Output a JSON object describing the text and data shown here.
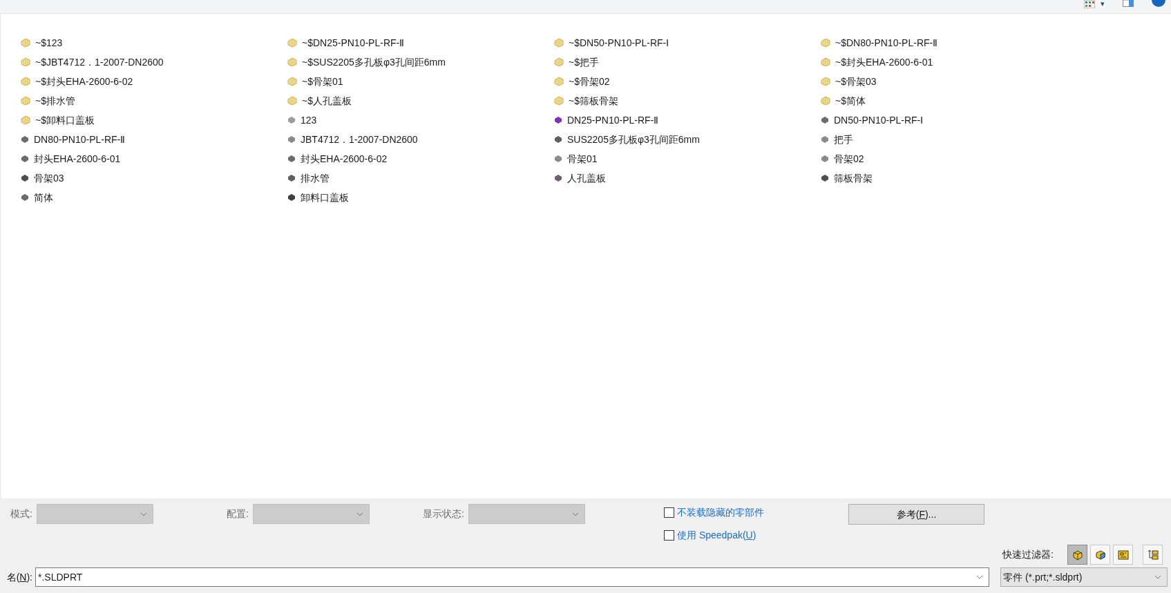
{
  "toolbar": {
    "view_menu_caret": "▾"
  },
  "files": [
    {
      "name": "~$123",
      "kind": "temp"
    },
    {
      "name": "~$DN25-PN10-PL-RF-Ⅱ",
      "kind": "temp"
    },
    {
      "name": "~$DN50-PN10-PL-RF-Ⅰ",
      "kind": "temp"
    },
    {
      "name": "~$DN80-PN10-PL-RF-Ⅱ",
      "kind": "temp"
    },
    {
      "name": "~$JBT4712．1-2007-DN2600",
      "kind": "temp"
    },
    {
      "name": "~$SUS2205多孔板φ3孔间距6mm",
      "kind": "temp"
    },
    {
      "name": "~$把手",
      "kind": "temp"
    },
    {
      "name": "~$封头EHA-2600-6-01",
      "kind": "temp"
    },
    {
      "name": "~$封头EHA-2600-6-02",
      "kind": "temp"
    },
    {
      "name": "~$骨架01",
      "kind": "temp"
    },
    {
      "name": "~$骨架02",
      "kind": "temp"
    },
    {
      "name": "~$骨架03",
      "kind": "temp"
    },
    {
      "name": "~$排水管",
      "kind": "temp"
    },
    {
      "name": "~$人孔盖板",
      "kind": "temp"
    },
    {
      "name": "~$筛板骨架",
      "kind": "temp"
    },
    {
      "name": "~$简体",
      "kind": "temp"
    },
    {
      "name": "~$卸料口盖板",
      "kind": "temp"
    },
    {
      "name": "123",
      "kind": "part",
      "color": "#9a9aa0"
    },
    {
      "name": "DN25-PN10-PL-RF-Ⅱ",
      "kind": "part",
      "color": "#7b2fbf"
    },
    {
      "name": "DN50-PN10-PL-RF-Ⅰ",
      "kind": "part",
      "color": "#6b6b74"
    },
    {
      "name": "DN80-PN10-PL-RF-Ⅱ",
      "kind": "part",
      "color": "#6b6b74"
    },
    {
      "name": "JBT4712．1-2007-DN2600",
      "kind": "part",
      "color": "#8a8a92"
    },
    {
      "name": "SUS2205多孔板φ3孔间距6mm",
      "kind": "part",
      "color": "#5e5e66"
    },
    {
      "name": "把手",
      "kind": "part",
      "color": "#8a8a92"
    },
    {
      "name": "封头EHA-2600-6-01",
      "kind": "part",
      "color": "#6b6b74"
    },
    {
      "name": "封头EHA-2600-6-02",
      "kind": "part",
      "color": "#6b6b74"
    },
    {
      "name": "骨架01",
      "kind": "part",
      "color": "#8a8a92"
    },
    {
      "name": "骨架02",
      "kind": "part",
      "color": "#8a8a92"
    },
    {
      "name": "骨架03",
      "kind": "part",
      "color": "#4e4e56"
    },
    {
      "name": "排水管",
      "kind": "part",
      "color": "#5e5e66"
    },
    {
      "name": "人孔盖板",
      "kind": "part",
      "color": "#6e5e6e"
    },
    {
      "name": "筛板骨架",
      "kind": "part",
      "color": "#4e4e56"
    },
    {
      "name": "简体",
      "kind": "part",
      "color": "#6b6b74"
    },
    {
      "name": "卸料口盖板",
      "kind": "part",
      "color": "#3e3e46"
    }
  ],
  "options": {
    "dropdowns": [
      {
        "label": "模式:",
        "disabled": true
      },
      {
        "label": "配置:",
        "disabled": true
      },
      {
        "label": "显示状态:",
        "disabled": true
      }
    ],
    "checkboxes": [
      {
        "label": "不装载隐藏的零部件",
        "checked": false
      },
      {
        "label_before": "使用 Speedpak(",
        "accel": "U",
        "label_after": ")",
        "checked": false
      }
    ],
    "references_button": {
      "label_before": "参考(",
      "accel": "F",
      "label_after": ")..."
    }
  },
  "quick_filter": {
    "label": "快速过滤器:",
    "buttons": [
      {
        "kind": "part",
        "selected": true
      },
      {
        "kind": "assembly",
        "selected": false
      },
      {
        "kind": "drawing",
        "selected": false
      },
      {
        "kind": "top-level",
        "selected": false
      }
    ]
  },
  "file_name": {
    "label_before": "名(",
    "accel": "N",
    "label_after": "):",
    "value": "*.SLDPRT"
  },
  "file_type": {
    "value": "零件 (*.prt;*.sldprt)"
  }
}
